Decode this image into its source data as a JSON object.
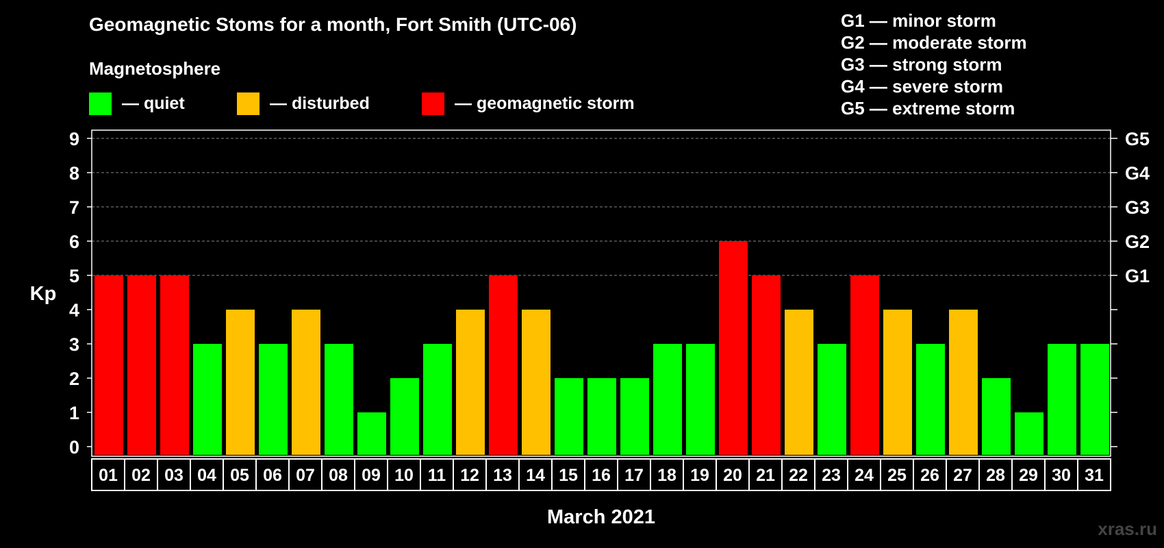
{
  "colors": {
    "quiet": "#00ff00",
    "disturbed": "#ffc000",
    "storm": "#ff0000",
    "background": "#000000",
    "grid": "#888888"
  },
  "legend": {
    "heading": "Magnetosphere",
    "quiet": "— quiet",
    "disturbed": "— disturbed",
    "storm": "— geomagnetic storm"
  },
  "gscale": [
    "G1 — minor storm",
    "G2 — moderate storm",
    "G3 — strong storm",
    "G4 — severe storm",
    "G5 — extreme storm"
  ],
  "watermark": "xras.ru",
  "chart_data": {
    "type": "bar",
    "title": "Geomagnetic Stoms for a month, Fort Smith (UTC-06)",
    "xlabel": "March 2021",
    "ylabel": "Kp",
    "ylim": [
      0,
      9
    ],
    "yticks": [
      0,
      1,
      2,
      3,
      4,
      5,
      6,
      7,
      8,
      9
    ],
    "right_axis_labels": [
      {
        "value": 5,
        "label": "G1"
      },
      {
        "value": 6,
        "label": "G2"
      },
      {
        "value": 7,
        "label": "G3"
      },
      {
        "value": 8,
        "label": "G4"
      },
      {
        "value": 9,
        "label": "G5"
      }
    ],
    "grid": "dashed horizontal at Kp 5-9",
    "categories": [
      "01",
      "02",
      "03",
      "04",
      "05",
      "06",
      "07",
      "08",
      "09",
      "10",
      "11",
      "12",
      "13",
      "14",
      "15",
      "16",
      "17",
      "18",
      "19",
      "20",
      "21",
      "22",
      "23",
      "24",
      "25",
      "26",
      "27",
      "28",
      "29",
      "30",
      "31"
    ],
    "values": [
      5,
      5,
      5,
      3,
      4,
      3,
      4,
      3,
      1,
      2,
      3,
      4,
      5,
      4,
      2,
      2,
      2,
      3,
      3,
      6,
      5,
      4,
      3,
      5,
      4,
      3,
      4,
      2,
      1,
      3,
      3
    ],
    "levels": [
      "storm",
      "storm",
      "storm",
      "quiet",
      "disturbed",
      "quiet",
      "disturbed",
      "quiet",
      "quiet",
      "quiet",
      "quiet",
      "disturbed",
      "storm",
      "disturbed",
      "quiet",
      "quiet",
      "quiet",
      "quiet",
      "quiet",
      "storm",
      "storm",
      "disturbed",
      "quiet",
      "storm",
      "disturbed",
      "quiet",
      "disturbed",
      "quiet",
      "quiet",
      "quiet",
      "quiet"
    ]
  }
}
